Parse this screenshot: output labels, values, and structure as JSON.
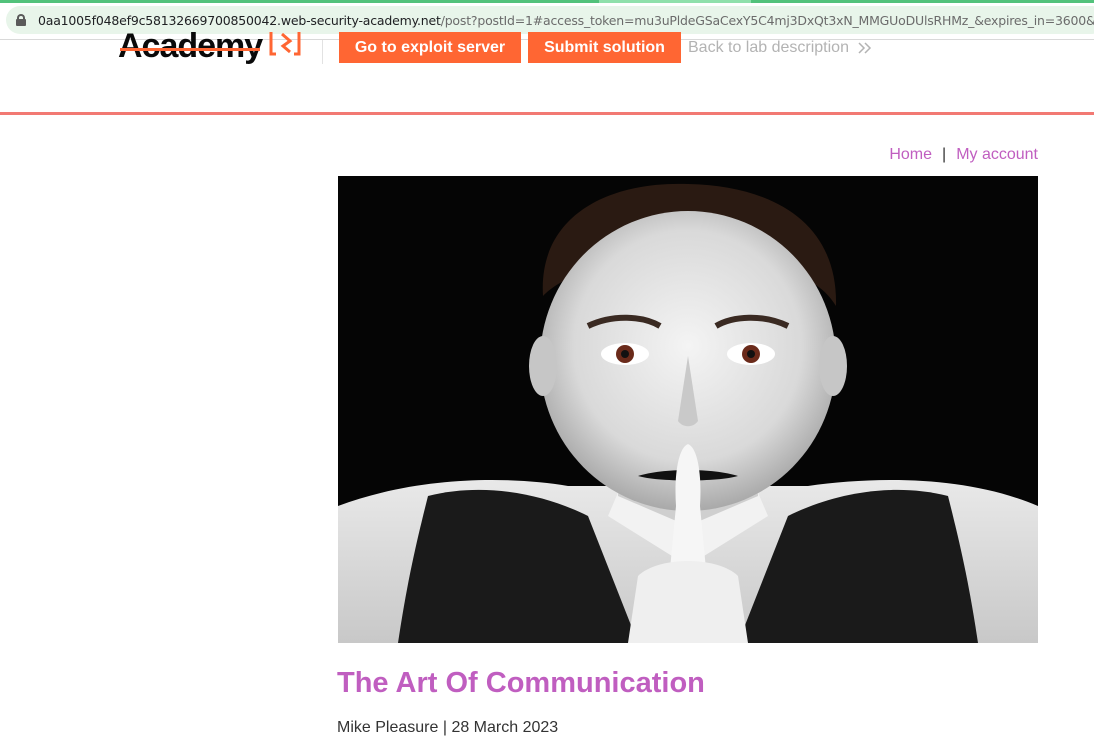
{
  "browser": {
    "url_host": "0aa1005f048ef9c58132669700850042.web-security-academy.net",
    "url_path": "/post?postId=1#access_token=mu3uPldeGSaCexY5C4mj3DxQt3xN_MMGUoDUlsRHMz_&expires_in=3600&"
  },
  "lab_header": {
    "logo_text": "Academy",
    "exploit_button": "Go to exploit server",
    "submit_button": "Submit solution",
    "back_link": "Back to lab description"
  },
  "nav": {
    "home": "Home",
    "separator": "|",
    "my_account": "My account"
  },
  "post": {
    "image_alt": "Mime artist with white face paint holding a finger to his lips",
    "title": "The Art Of Communication",
    "author": "Mike Pleasure",
    "byline_separator": "|",
    "date": "28 March 2023"
  },
  "colors": {
    "accent": "#ff6633",
    "link": "#c05ec0",
    "rule": "#f0615a",
    "url_bar": "#e8f5ea"
  }
}
